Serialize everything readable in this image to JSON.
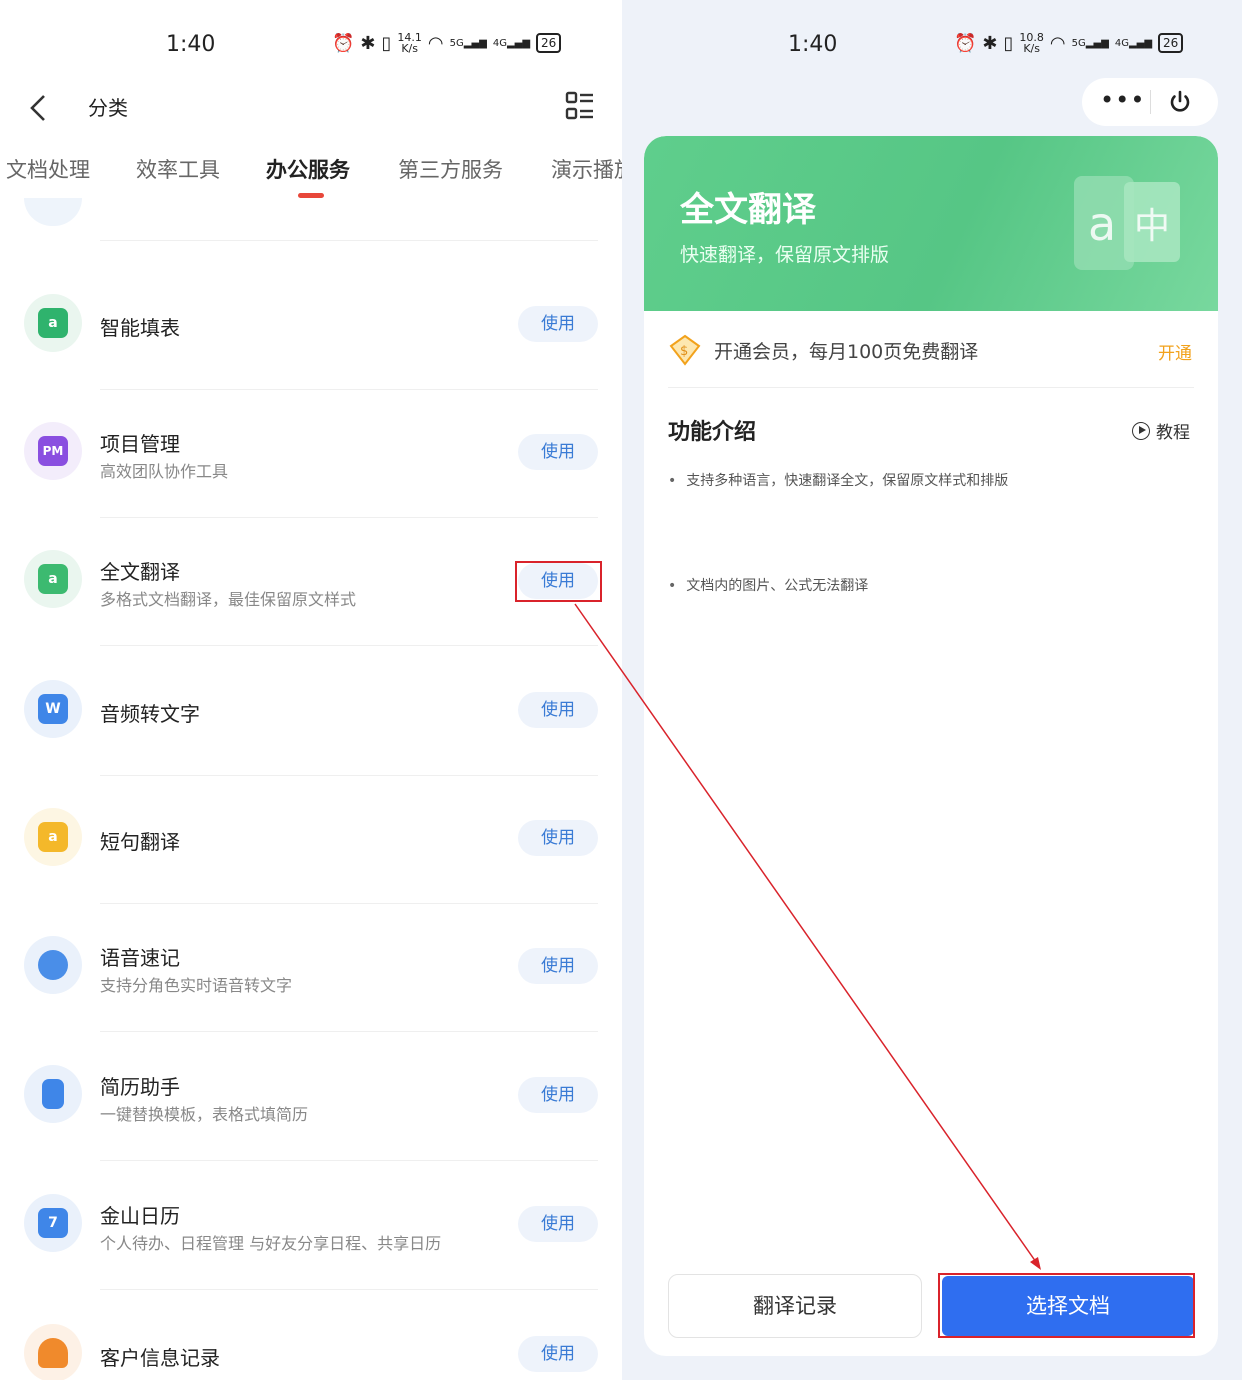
{
  "left": {
    "status": {
      "time": "1:40",
      "speed_top": "14.1",
      "speed_bottom": "K/s",
      "sig1": "5G",
      "sig2": "4G",
      "battery": "26"
    },
    "nav": {
      "title": "分类"
    },
    "tabs": [
      {
        "label": "文档处理"
      },
      {
        "label": "效率工具"
      },
      {
        "label": "办公服务"
      },
      {
        "label": "第三方服务"
      },
      {
        "label": "演示播放"
      }
    ],
    "use_label": "使用",
    "items": [
      {
        "name": "智能填表",
        "desc": "",
        "icon": "smart-form-icon",
        "icon_glyph": "a"
      },
      {
        "name": "项目管理",
        "desc": "高效团队协作工具",
        "icon": "project-management-icon",
        "icon_glyph": "PM"
      },
      {
        "name": "全文翻译",
        "desc": "多格式文档翻译，最佳保留原文样式",
        "icon": "full-translate-icon",
        "icon_glyph": "a"
      },
      {
        "name": "音频转文字",
        "desc": "",
        "icon": "audio-to-text-icon",
        "icon_glyph": "W"
      },
      {
        "name": "短句翻译",
        "desc": "",
        "icon": "short-translate-icon",
        "icon_glyph": "a"
      },
      {
        "name": "语音速记",
        "desc": "支持分角色实时语音转文字",
        "icon": "voice-note-icon",
        "icon_glyph": ""
      },
      {
        "name": "简历助手",
        "desc": "一键替换模板，表格式填简历",
        "icon": "resume-icon",
        "icon_glyph": ""
      },
      {
        "name": "金山日历",
        "desc": "个人待办、日程管理 与好友分享日程、共享日历",
        "icon": "calendar-icon",
        "icon_glyph": "7"
      },
      {
        "name": "客户信息记录",
        "desc": "",
        "icon": "customer-record-icon",
        "icon_glyph": ""
      }
    ]
  },
  "right": {
    "status": {
      "time": "1:40",
      "speed_top": "10.8",
      "speed_bottom": "K/s",
      "sig1": "5G",
      "sig2": "4G",
      "battery": "26"
    },
    "banner": {
      "title": "全文翻译",
      "subtitle": "快速翻译，保留原文排版"
    },
    "vip": {
      "text": "开通会员，每月100页免费翻译",
      "link": "开通"
    },
    "intro": {
      "title": "功能介绍",
      "tutorial": "教程",
      "bullets": [
        "支持多种语言，快速翻译全文，保留原文样式和排版",
        "文档内的图片、公式无法翻译"
      ]
    },
    "buttons": {
      "history": "翻译记录",
      "choose": "选择文档"
    }
  },
  "colors": {
    "accent_blue": "#2f6ef0",
    "banner_green": "#5fce8c",
    "tab_indicator": "#e8473a",
    "vip_orange": "#f2a21c",
    "annotation_red": "#d9232b"
  }
}
